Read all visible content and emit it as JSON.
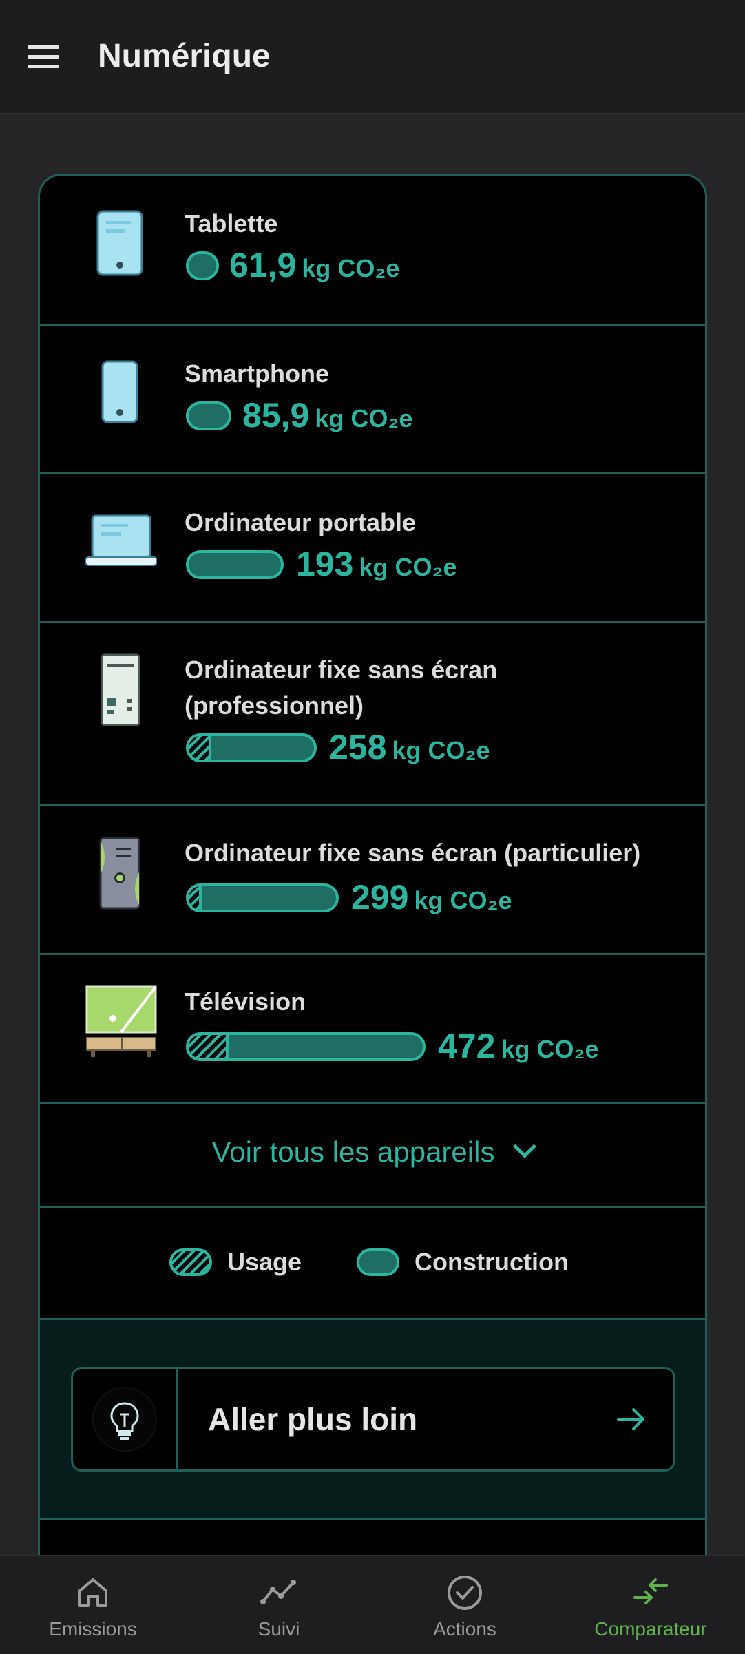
{
  "header": {
    "title": "Numérique"
  },
  "devices": [
    {
      "name": "Tablette",
      "value": "61,9",
      "unit": "kg CO₂e",
      "usage_fraction": 0.0,
      "icon": "tablet-icon"
    },
    {
      "name": "Smartphone",
      "value": "85,9",
      "unit": "kg CO₂e",
      "usage_fraction": 0.0,
      "icon": "smartphone-icon"
    },
    {
      "name": "Ordinateur portable",
      "value": "193",
      "unit": "kg CO₂e",
      "usage_fraction": 0.0,
      "icon": "laptop-icon"
    },
    {
      "name": "Ordinateur fixe sans écran (professionnel)",
      "value": "258",
      "unit": "kg CO₂e",
      "usage_fraction": 0.17,
      "icon": "desktop-pro-icon"
    },
    {
      "name": "Ordinateur fixe sans écran (particulier)",
      "value": "299",
      "unit": "kg CO₂e",
      "usage_fraction": 0.08,
      "icon": "desktop-home-icon"
    },
    {
      "name": "Télévision",
      "value": "472",
      "unit": "kg CO₂e",
      "usage_fraction": 0.16,
      "icon": "television-icon"
    }
  ],
  "see_all": {
    "label": "Voir tous les appareils"
  },
  "legend": {
    "usage": "Usage",
    "construction": "Construction"
  },
  "more": {
    "label": "Aller plus loin"
  },
  "nav": {
    "emissions": "Emissions",
    "suivi": "Suivi",
    "actions": "Actions",
    "comparateur": "Comparateur",
    "active": "comparateur"
  },
  "colors": {
    "accent": "#2bb59f",
    "active_nav": "#60b14b",
    "border": "#1f5f58"
  }
}
